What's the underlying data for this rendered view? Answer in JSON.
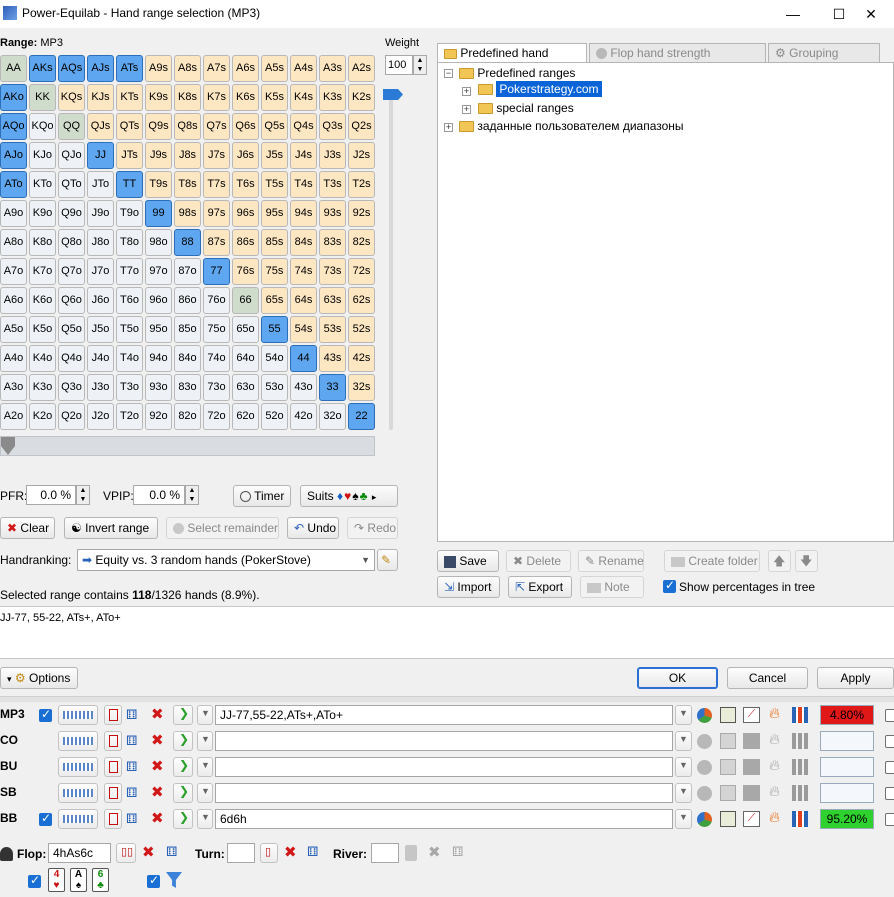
{
  "window": {
    "title": "Power-Equilab - Hand range selection (MP3)",
    "min": "—",
    "max": "☐",
    "close": "✕"
  },
  "range": {
    "label": "Range:",
    "name": "MP3",
    "weight_label": "Weight",
    "weight_value": "100"
  },
  "grid": {
    "ranks": [
      "A",
      "K",
      "Q",
      "J",
      "T",
      "9",
      "8",
      "7",
      "6",
      "5",
      "4",
      "3",
      "2"
    ],
    "selected": [
      "AKs",
      "AQs",
      "AJs",
      "ATs",
      "AKo",
      "AQo",
      "AJo",
      "JJ",
      "ATo",
      "TT",
      "99",
      "88",
      "77",
      "55",
      "44",
      "33",
      "22"
    ]
  },
  "stats": {
    "pfr_label": "PFR:",
    "pfr_value": "0.0 %",
    "vpip_label": "VPIP:",
    "vpip_value": "0.0 %",
    "timer": "Timer",
    "suits": "Suits",
    "suit_symbols": "♦♥♠♣"
  },
  "actions": {
    "clear": "Clear",
    "invert": "Invert range",
    "select_remainder": "Select remainder",
    "undo": "Undo",
    "redo": "Redo"
  },
  "handranking": {
    "label": "Handranking:",
    "value": "Equity vs. 3 random hands (PokerStove)"
  },
  "summary": {
    "prefix": "Selected range contains ",
    "count": "118",
    "suffix": "/1326 hands (8.9%)."
  },
  "range_text": "JJ-77, 55-22, ATs+, ATo+",
  "tabs": {
    "predefined": "Predefined hand ranges",
    "flop": "Flop hand strength distribution",
    "grouping": "Grouping options"
  },
  "tree": {
    "root": "Predefined ranges",
    "child1": "Pokerstrategy.com",
    "child2": "special ranges",
    "user": "заданные пользователем диапазоны"
  },
  "tree_buttons": {
    "save": "Save",
    "delete": "Delete",
    "rename": "Rename",
    "create_folder": "Create folder",
    "import": "Import",
    "export": "Export",
    "note": "Note",
    "show_pct": "Show percentages in tree"
  },
  "dialog": {
    "options": "Options",
    "ok": "OK",
    "cancel": "Cancel",
    "apply": "Apply"
  },
  "players": [
    {
      "name": "MP3",
      "checked": true,
      "range": "JJ-77,55-22,ATs+,ATo+",
      "equity": "4.80%",
      "eq_color": "#e01818"
    },
    {
      "name": "CO",
      "checked": false,
      "range": "",
      "equity": "",
      "eq_color": "#f4f8fc"
    },
    {
      "name": "BU",
      "checked": false,
      "range": "",
      "equity": "",
      "eq_color": "#f4f8fc"
    },
    {
      "name": "SB",
      "checked": false,
      "range": "",
      "equity": "",
      "eq_color": "#f4f8fc"
    },
    {
      "name": "BB",
      "checked": true,
      "range": "6d6h",
      "equity": "95.20%",
      "eq_color": "#2fd12f"
    }
  ],
  "board": {
    "flop_label": "Flop:",
    "flop_value": "4hAs6c",
    "turn_label": "Turn:",
    "turn_value": "",
    "river_label": "River:",
    "river_value": "",
    "cards": [
      {
        "rank": "4",
        "suit": "♥",
        "color": "#d01010"
      },
      {
        "rank": "A",
        "suit": "♠",
        "color": "#000000"
      },
      {
        "rank": "6",
        "suit": "♣",
        "color": "#0a8a0a"
      }
    ]
  }
}
